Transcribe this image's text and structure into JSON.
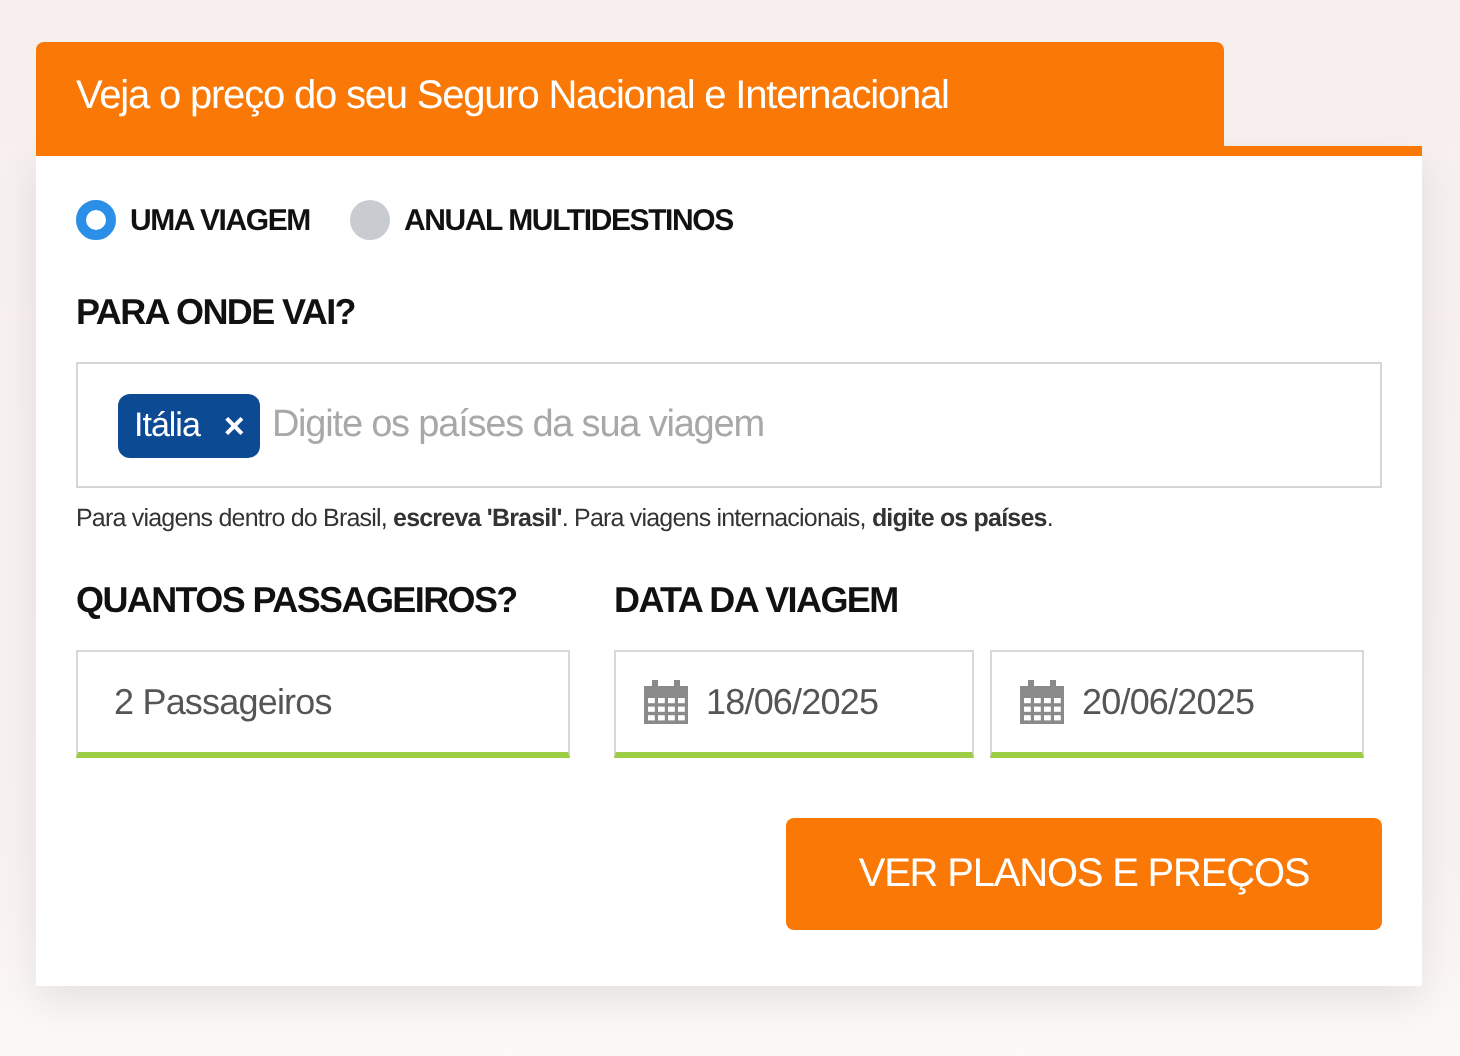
{
  "title": "Veja o preço do seu Seguro Nacional e Internacional",
  "trip_types": [
    {
      "label": "UMA VIAGEM",
      "selected": true
    },
    {
      "label": "ANUAL MULTIDESTINOS",
      "selected": false
    }
  ],
  "destination": {
    "label": "PARA ONDE VAI?",
    "tags": [
      {
        "label": "Itália",
        "remove": "×"
      }
    ],
    "placeholder": "Digite os países da sua viagem"
  },
  "hint": "Para viagens dentro do Brasil, **escreva 'Brasil'**. Para viagens internacionais, **digite os países**.",
  "passengers": {
    "label": "QUANTOS PASSAGEIROS?",
    "value": "2 Passageiros"
  },
  "dates": {
    "label": "DATA DA VIAGEM",
    "fields": [
      {
        "value": "18/06/2025"
      },
      {
        "value": "20/06/2025"
      }
    ]
  },
  "submit": "VER PLANOS E PREÇOS"
}
